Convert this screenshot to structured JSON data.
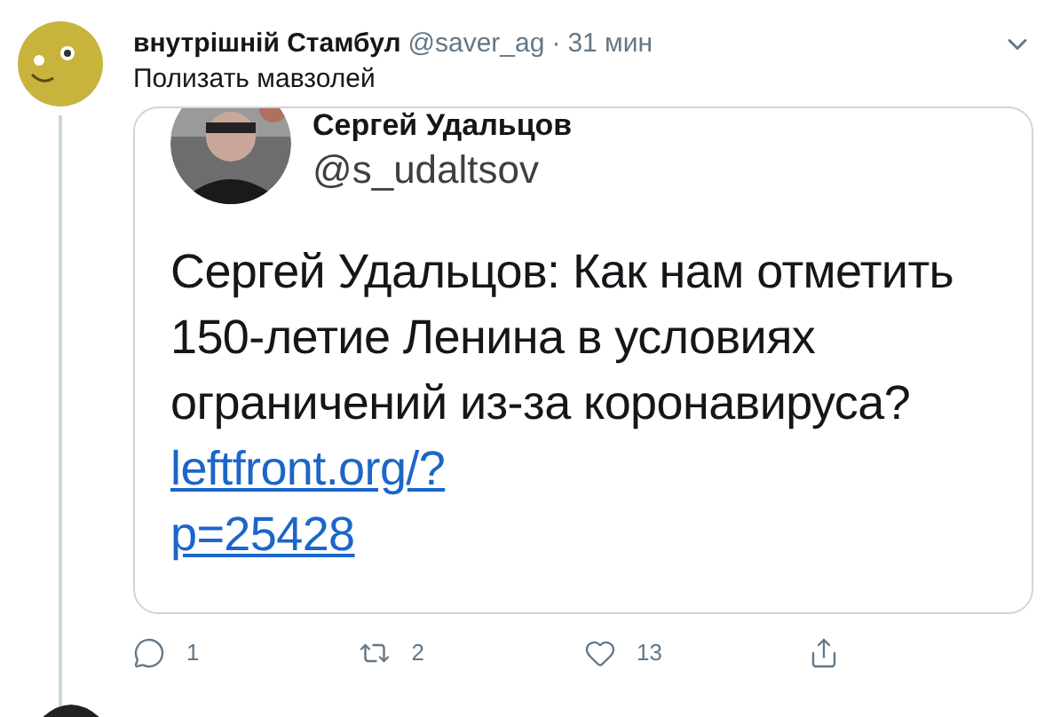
{
  "tweet": {
    "name": "внутрішній Стамбул",
    "handle": "@saver_ag",
    "separator": "·",
    "time": "31 мин",
    "text": "Полизать мавзолей"
  },
  "embedded": {
    "name": "Сергей Удальцов",
    "handle": "@s_udaltsov",
    "text": "Сергей Удальцов: Как нам отметить 150-летие Ленина в условиях ограничений из-за коронавируса?",
    "link_lines": [
      "leftfront.org/?",
      "p=25428"
    ]
  },
  "actions": [
    {
      "kind": "reply",
      "count": "1"
    },
    {
      "kind": "retweet",
      "count": "2"
    },
    {
      "kind": "like",
      "count": "13"
    },
    {
      "kind": "share"
    }
  ]
}
